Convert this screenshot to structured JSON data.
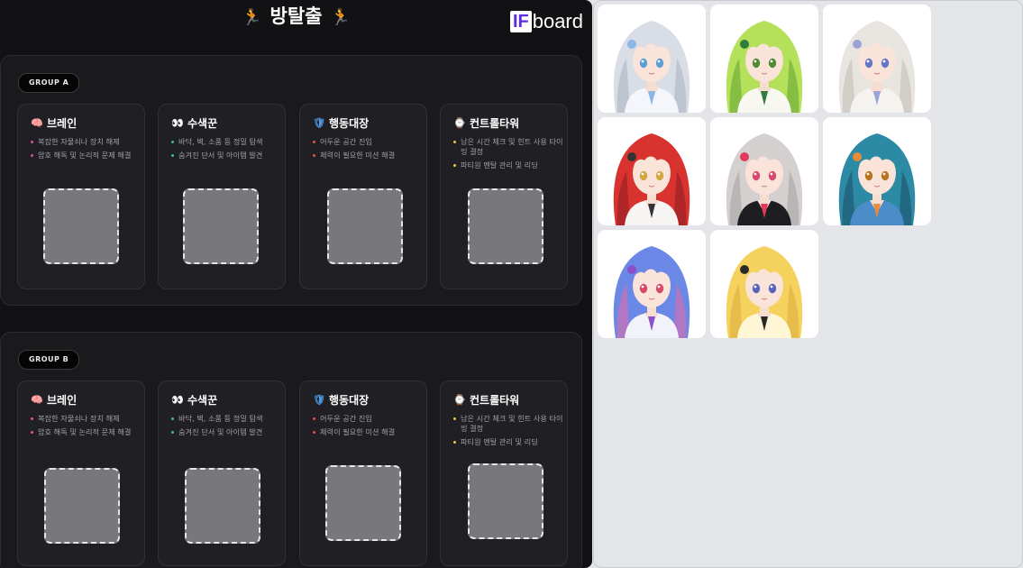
{
  "title": "방탈출",
  "title_icon": "runner-icon",
  "logo": {
    "if": "IF",
    "board": "board"
  },
  "groups": [
    {
      "tag": "GROUP A",
      "roles": [
        {
          "icon": "brain-icon",
          "name": "브레인",
          "bullets": [
            "복잡한 자물쇠나 장치 해제",
            "암호 해독 및 논리적 문제 해결"
          ]
        },
        {
          "icon": "eyes-icon",
          "name": "수색꾼",
          "bullets": [
            "바닥, 벽, 소품 등 정밀 탐색",
            "숨겨진 단서 및 아이템 발견"
          ]
        },
        {
          "icon": "shield-icon",
          "name": "행동대장",
          "bullets": [
            "어두운 공간 진입",
            "체력이 필요한 미션 해결"
          ]
        },
        {
          "icon": "clock-icon",
          "name": "컨트롤타워",
          "bullets": [
            "남은 시간 체크 및 힌트 사용 타이밍 결정",
            "파티원 멘탈 관리 및 리딩"
          ]
        }
      ]
    },
    {
      "tag": "GROUP B",
      "roles": [
        {
          "icon": "brain-icon",
          "name": "브레인",
          "bullets": [
            "복잡한 자물쇠나 장치 해제",
            "암호 해독 및 논리적 문제 해결"
          ]
        },
        {
          "icon": "eyes-icon",
          "name": "수색꾼",
          "bullets": [
            "바닥, 벽, 소품 등 정밀 탐색",
            "숨겨진 단서 및 아이템 발견"
          ]
        },
        {
          "icon": "shield-icon",
          "name": "행동대장",
          "bullets": [
            "어두운 공간 진입",
            "체력이 필요한 미션 해결"
          ]
        },
        {
          "icon": "clock-icon",
          "name": "컨트롤타워",
          "bullets": [
            "남은 시간 체크 및 힌트 사용 타이밍 결정",
            "파티원 멘탈 관리 및 리딩"
          ]
        }
      ]
    }
  ],
  "colors": {
    "brain": "#f07ac0",
    "eyes": "#b0b0b8",
    "shield": "#4f9be8",
    "clock": "#b57ad8",
    "bullet_brain": "#e04fa0",
    "bullet_eyes": "#3fbf7f",
    "bullet_shield": "#e05050",
    "bullet_clock": "#e6c94a"
  },
  "avatars": [
    {
      "hair": "#d9dde6",
      "dark": "#a8b0bf",
      "eyes": "#5a9fd4",
      "outfit": "#f4f6fb",
      "accent": "#8ab6e8",
      "bg": "#ffffff"
    },
    {
      "hair": "#b4e05a",
      "dark": "#5fa232",
      "eyes": "#4f8c30",
      "outfit": "#f7f9f0",
      "accent": "#2f7d3c",
      "bg": "#ffffff"
    },
    {
      "hair": "#e8e4e0",
      "dark": "#c0bab3",
      "eyes": "#6676c4",
      "outfit": "#f5f3f0",
      "accent": "#9aa4d8",
      "bg": "#ffffff"
    },
    {
      "hair": "#d8332e",
      "dark": "#8c1b22",
      "eyes": "#d2a640",
      "outfit": "#f7f5f3",
      "accent": "#333333",
      "bg": "#ffffff"
    },
    {
      "hair": "#d4d0d0",
      "dark": "#a49e9e",
      "eyes": "#d64a6e",
      "outfit": "#1d1d22",
      "accent": "#e23a5a",
      "bg": "#ffffff"
    },
    {
      "hair": "#2c8aa4",
      "dark": "#1b4d66",
      "eyes": "#b8741f",
      "outfit": "#4b8dc9",
      "accent": "#e88b3a",
      "bg": "#ffffff"
    },
    {
      "hair": "#6c88e6",
      "dark": "#e86aa8",
      "eyes": "#d84868",
      "outfit": "#f2f3fa",
      "accent": "#8a4fc9",
      "bg": "#ffffff"
    },
    {
      "hair": "#f5d25e",
      "dark": "#d9a93a",
      "eyes": "#5864b8",
      "outfit": "#fff6d6",
      "accent": "#2a2a2a",
      "bg": "#ffffff"
    }
  ]
}
